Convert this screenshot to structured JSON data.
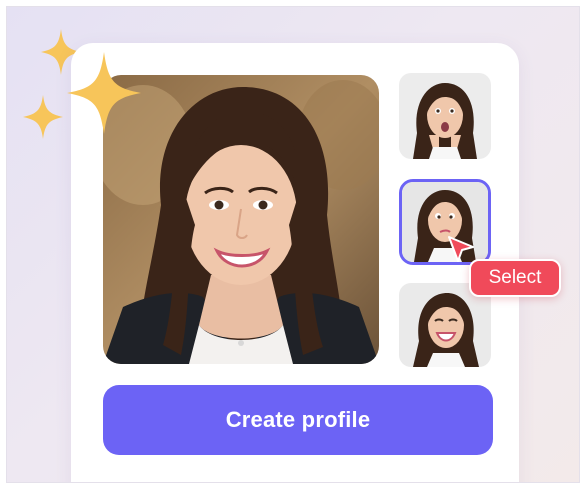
{
  "card": {
    "main_photo": {
      "description_icon": "portrait-smiling"
    },
    "thumbnails": [
      {
        "icon": "portrait-surprised",
        "selected": false
      },
      {
        "icon": "portrait-playful",
        "selected": true
      },
      {
        "icon": "portrait-laughing",
        "selected": false
      }
    ],
    "create_button_label": "Create profile"
  },
  "tooltip": {
    "select_label": "Select"
  },
  "colors": {
    "accent": "#6c63f5",
    "badge": "#f04a5a",
    "sparkle": "#f7c55a"
  }
}
